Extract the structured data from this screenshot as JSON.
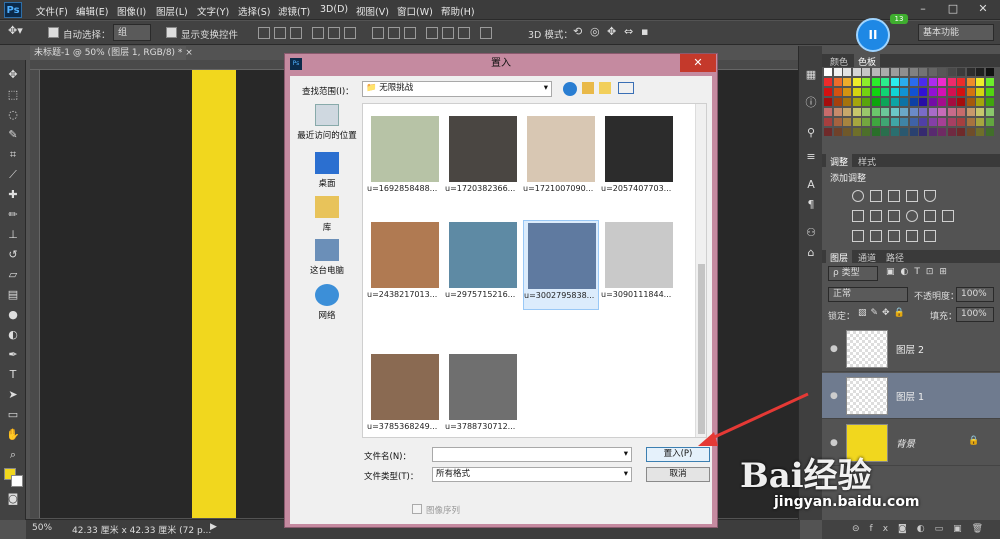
{
  "app": {
    "logo_text": "Ps"
  },
  "menu": [
    "文件(F)",
    "编辑(E)",
    "图像(I)",
    "图层(L)",
    "文字(Y)",
    "选择(S)",
    "滤镜(T)",
    "3D(D)",
    "视图(V)",
    "窗口(W)",
    "帮助(H)"
  ],
  "window_controls": [
    "–",
    "□",
    "✕"
  ],
  "options_bar": {
    "auto_select_label": "自动选择：",
    "auto_select_value": "组",
    "show_transform_label": "显示变换控件",
    "mode_3d_label": "3D 模式：",
    "workspace_value": "基本功能"
  },
  "document_tab": {
    "label": "未标题-1 @ 50% (图层 1, RGB/8) *",
    "close": "×"
  },
  "status": {
    "zoom": "50%",
    "info": "42.33 厘米 x 42.33 厘米 (72 p..."
  },
  "colors": {
    "foreground": "#f1d71e",
    "background": "#ffffff",
    "accent": "#1e88e5"
  },
  "panels": {
    "swatch_tabs": [
      "颜色",
      "色板"
    ],
    "adjust_tabs": [
      "调整",
      "样式"
    ],
    "adjust_title": "添加调整",
    "layers_tabs": [
      "图层",
      "通道",
      "路径"
    ],
    "kind_label": "ρ 类型",
    "blend_mode": "正常",
    "opacity_label": "不透明度：",
    "opacity_value": "100%",
    "lock_label": "锁定：",
    "fill_label": "填充：",
    "fill_value": "100%",
    "layers": [
      {
        "name": "图层 2",
        "visible": "●"
      },
      {
        "name": "图层 1",
        "visible": "●"
      },
      {
        "name": "背景",
        "visible": "●"
      }
    ]
  },
  "dialog": {
    "title": "置入",
    "close": "✕",
    "look_in_label": "查找范围(I)：",
    "look_in_value": "无限挑战",
    "places": [
      "最近访问的位置",
      "桌面",
      "库",
      "这台电脑",
      "网络"
    ],
    "files": [
      {
        "name": "u=1692858488..."
      },
      {
        "name": "u=1720382366..."
      },
      {
        "name": "u=1721007090..."
      },
      {
        "name": "u=2057407703..."
      },
      {
        "name": "u=2438217013..."
      },
      {
        "name": "u=2975715216..."
      },
      {
        "name": "u=3002795838..."
      },
      {
        "name": "u=3090111844..."
      },
      {
        "name": "u=3785368249..."
      },
      {
        "name": "u=3788730712..."
      }
    ],
    "filename_label": "文件名(N)：",
    "filename_value": "",
    "filetype_label": "文件类型(T)：",
    "filetype_value": "所有格式",
    "place_button": "置入(P)",
    "cancel_button": "取消",
    "image_sequence_label": "图像序列"
  },
  "overlay": {
    "badge_count": "13",
    "pause_symbol": "II"
  },
  "watermark": {
    "logo": "Bai经验",
    "url": "jingyan.baidu.com"
  }
}
